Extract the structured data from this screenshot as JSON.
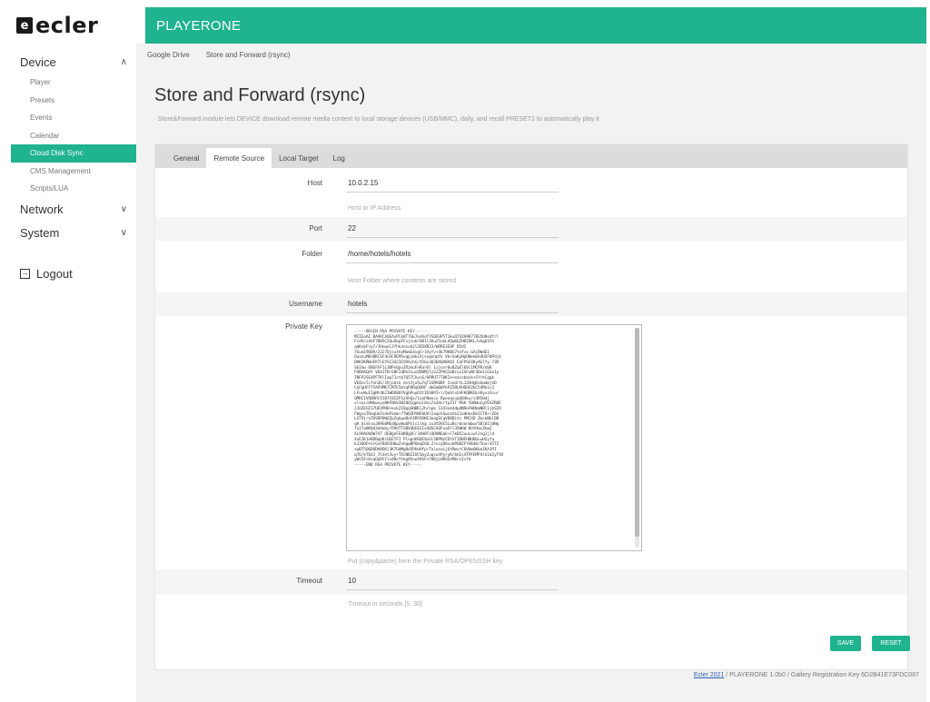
{
  "brand": {
    "logo_letter": "e",
    "logo_text": "ecler",
    "app_title": "PLAYERONE"
  },
  "sidebar": {
    "sections": [
      {
        "label": "Device",
        "chevron": "up",
        "items": [
          {
            "label": "Player"
          },
          {
            "label": "Presets"
          },
          {
            "label": "Events"
          },
          {
            "label": "Calendar"
          },
          {
            "label": "Cloud Disk Sync",
            "active": true
          },
          {
            "label": "CMS Management"
          },
          {
            "label": "Scripts/LUA"
          }
        ]
      },
      {
        "label": "Network",
        "chevron": "down"
      },
      {
        "label": "System",
        "chevron": "down"
      }
    ],
    "logout_label": "Logout"
  },
  "breadcrumb": [
    "Google Drive",
    "Store and Forward (rsync)"
  ],
  "page": {
    "title": "Store and Forward (rsync)",
    "description": "Store&Forward module lets DEVICE download remote media content to local storage devices (USB/MMC), daily, and recall PRESET1 to automatically play it"
  },
  "tabs": [
    {
      "label": "General"
    },
    {
      "label": "Remote Source",
      "active": true
    },
    {
      "label": "Local Target"
    },
    {
      "label": "Log"
    }
  ],
  "form": {
    "host": {
      "label": "Host",
      "value": "10.0.2.15",
      "hint": "Host or IP Address"
    },
    "port": {
      "label": "Port",
      "value": "22"
    },
    "folder": {
      "label": "Folder",
      "value": "/home/hotels/hotels",
      "hint": "Host Folder where contents are stored"
    },
    "username": {
      "label": "Username",
      "value": "hotels"
    },
    "private_key": {
      "label": "Private Key",
      "value": "-----BEGIN RSA PRIVATE KEY-----\nMIIEoAI BAAKCAQEAxPCk8T7Gk7osKoY7G6R3P5T1kuQ7V2H9K7T8G5bNsdtrl\nFcdVcsdeF7B05C2QuSbpFFvjvuU/8B1l1Ku25cmL4QwbQ2HDZOKLJv6g61Fh\nqaKsbFrp7/JHnwol2fhkznsvb2l2EDXB23/WORE3E8F D5dI\n7Gum19Q09/2227QjsuthaMamE4xqC+1VyYv+4k79H0G7tafvx.GAcDWdEI\nQuazuMbnBKCSF4nSC9EM5vqpjmk1Vjsxgnnptk Vb+SaKyNpQNemSkdUSF0Pdj6\nDKK2KRWeFKTLEYSC3423E5RAchG/X5Gx3Q3DAQABAOI EaFPSEXKyAGlYy 73R\nSbImu 6BGFhF1i3BPvQpuIRzkuFnKar6l 1zjuvr0u8ZqEl6Vc1MCPR/mSK\nFHBHXGHY VOkITD+SBF2dDhZvuxVDBMj5jS2ZPVGImBruzISFuNF4De1iEGo1y\nINFP2SG4PFTKlIap71ctb7Q5TCkvuS/6RRUT7T0KIa+eacsback+SYrkCggk\nVE8sxTcfnh3E/19jodik dvt3jo5u7qT1GMA0BF InvUrtL1ZhHgKs6wdmjVD\nCoFgHFY75AFHMK7CM7E5btqPURqQOHF dmSm6WYkPZ5BLKHQQX2bC54Ma1c2\nLFuvWuIIgNtdb21WDO80YVgbPuyDItIEU0PI+l/QnHlsEAFKQBKOLnRyvzXsu/\nQMRCIVODRPL5187C0IZFSzXhQx/IyaFNmnsz RpeeqsuqSB4ku/s4R58dj\nvlsoicHNkwvysBKFNXV3B28QIgphul0zu7aJHsrtpI3T MSK 5O6WuCgYEAZR0E\nJJUZEGIS7UEVPHB+kvk2I8gqSNBKl2h/npk 1343xk4dpdNReFWHbmNBl1jbSIR\nFWgvaTReqUoFo4ePzmm+77WQZHYWF0UVlIaqLhSwsatbI1odHoxDeIIT8++Z6h\nLGT9jrzZVSRP6WQZpZqkpeBnF4RFOOKE3oogSCgV8BDLtz PMCXD ZmskBblDB\nqK bimlsoJ09G8MEdQpuWu6Polcilkg zu3tDVE5LuBcrbnnnmbw/5Bl01l0Nq\nTu1Ta8K0d3eHaby/PHdTTSBVdBU1EIx40SCAOFuaOll3SWbW KUtHmcZmaZ\nXL9HAOkDW7VT OEBgnFEQKBgQCr3400TiQDHNGak+C7kB52uuLvwlJngJjld\n4vEIK1eKDBqUKrUEETFI PlnpdHSDE9uSl5BPNzCDtSTIDNFHBHBGLwHIyfa\nkJ3QOP+GrGsFBdS5H6wZvhgwBPQkqEG0.ZrvcyD8vuUP6B2FYH640/5ho+35TZ\nswBT5Q6DODA8SKl3K7GHMgBd5PbUHfprTalozaLj6tRmvrC8Vbm6KbaIKA1PI\nq76/kT6XJ 7h1et3vy+TECNBIIOCSby2uqsuhPyryKrbAIs4TPFEMP4lS1d2yTXV\nyWs5FcbsqOpRtIln4NsYtkg85nwtKSFn78BjLH8SGnMbrsIsfd\n-----END RSA PRIVATE KEY-----",
      "hint": "Put (copy&paste) here the Private RSA/OPENSSH key"
    },
    "timeout": {
      "label": "Timeout",
      "value": "10",
      "hint": "Timeout in seconds [5..30]"
    }
  },
  "buttons": {
    "save": "SAVE",
    "reset": "RESET"
  },
  "footer": {
    "link": "Ecler 2021",
    "text": " / PLAYERONE 1.0b0 / Gallery Registration Key 6D2B41E73FDC087"
  },
  "colors": {
    "accent": "#1fb38f",
    "link": "#2a5fb5",
    "page_bg": "#f2f2f2"
  }
}
